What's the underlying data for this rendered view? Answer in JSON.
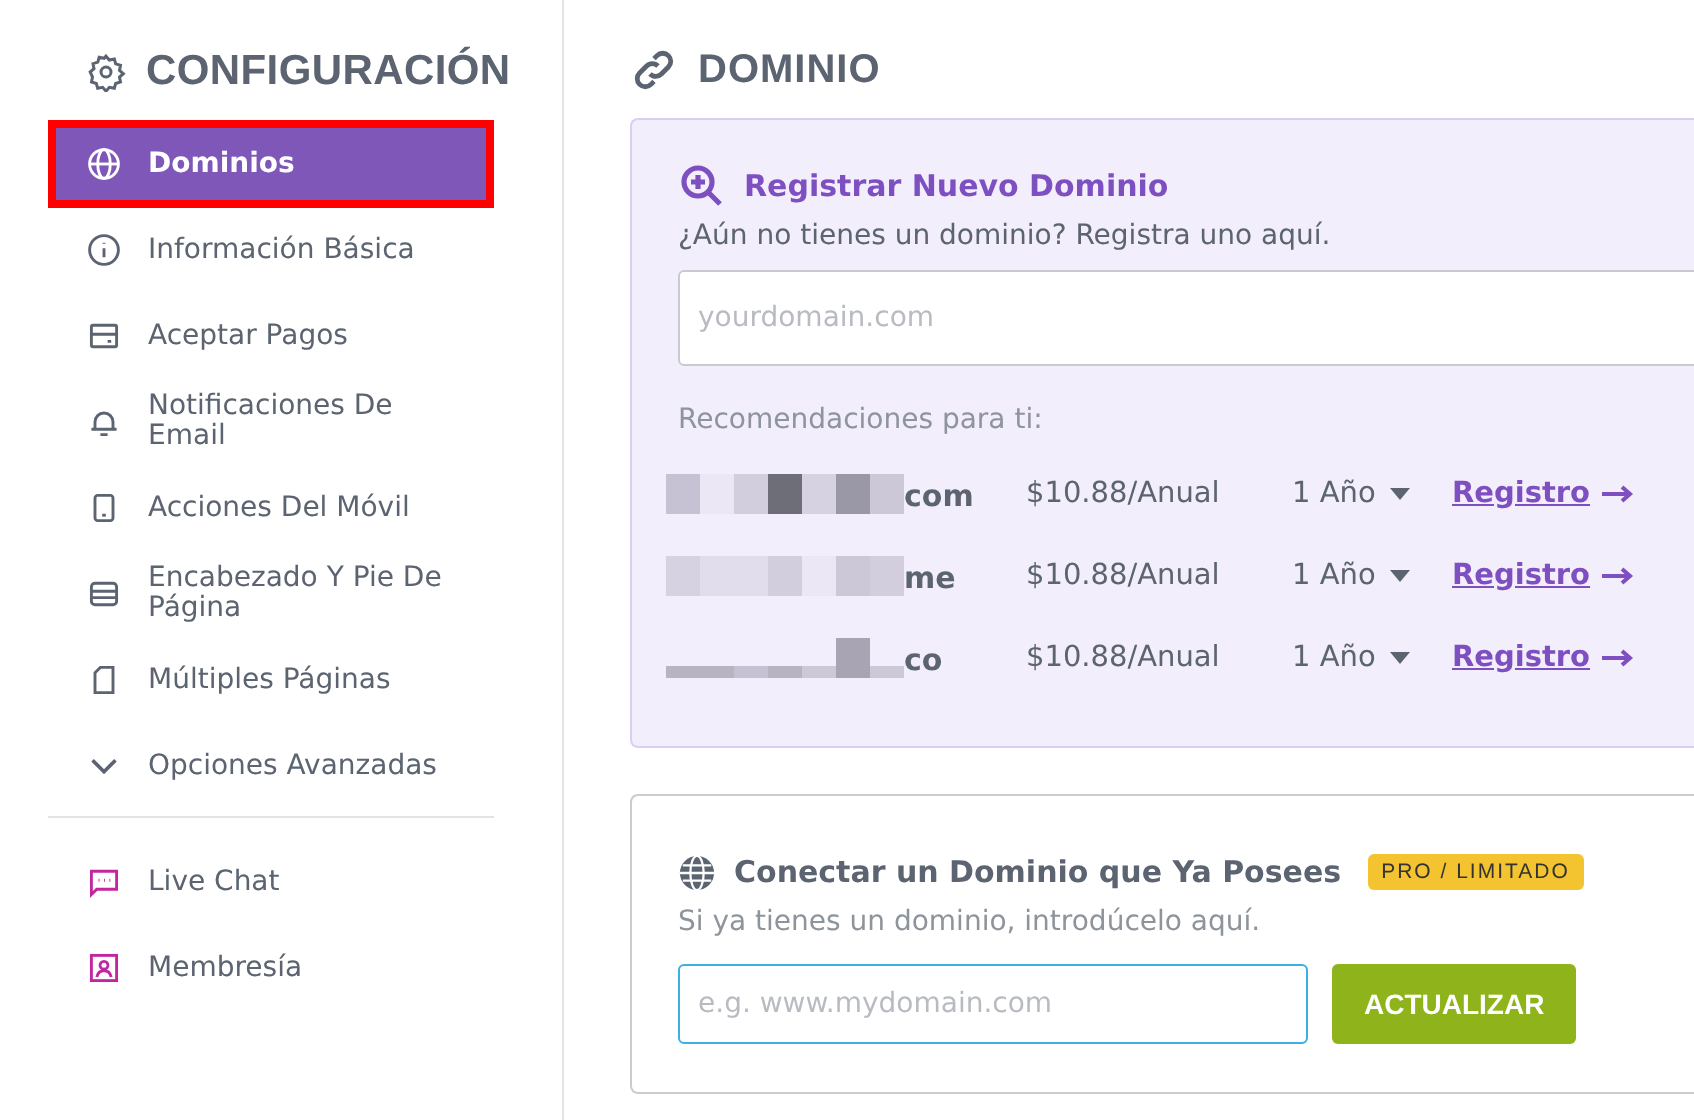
{
  "sidebar": {
    "title": "CONFIGURACIÓN",
    "groups": [
      [
        {
          "label": "Dominios",
          "selected": true,
          "highlighted": true
        },
        {
          "label": "Información Básica",
          "selected": false,
          "highlighted": false
        },
        {
          "label": "Aceptar Pagos",
          "selected": false,
          "highlighted": false
        },
        {
          "label": "Notificaciones De Email",
          "selected": false,
          "highlighted": false
        },
        {
          "label": "Acciones Del Móvil",
          "selected": false,
          "highlighted": false
        },
        {
          "label": "Encabezado Y Pie De Página",
          "selected": false,
          "highlighted": false
        },
        {
          "label": "Múltiples Páginas",
          "selected": false,
          "highlighted": false
        },
        {
          "label": "Opciones Avanzadas",
          "selected": false,
          "highlighted": false
        }
      ],
      [
        {
          "label": "Live Chat",
          "selected": false,
          "highlighted": false
        },
        {
          "label": "Membresía",
          "selected": false,
          "highlighted": false
        }
      ]
    ]
  },
  "main": {
    "title": "DOMINIO",
    "register": {
      "title": "Registrar Nuevo Dominio",
      "subtitle": "¿Aún no tienes un dominio? Registra uno aquí.",
      "placeholder": "yourdomain.com",
      "recommendations_label": "Recomendaciones para ti:",
      "rows": [
        {
          "tld": "com",
          "price": "$10.88/Anual",
          "period": "1 Año",
          "action": "Registro"
        },
        {
          "tld": "me",
          "price": "$10.88/Anual",
          "period": "1 Año",
          "action": "Registro"
        },
        {
          "tld": "co",
          "price": "$10.88/Anual",
          "period": "1 Año",
          "action": "Registro"
        }
      ]
    },
    "connect": {
      "title": "Conectar un Dominio que Ya Posees",
      "badge": "PRO / LIMITADO",
      "subtitle": "Si ya tienes un dominio, introdúcelo aquí.",
      "placeholder": "e.g. www.mydomain.com",
      "button": "ACTUALIZAR"
    }
  }
}
